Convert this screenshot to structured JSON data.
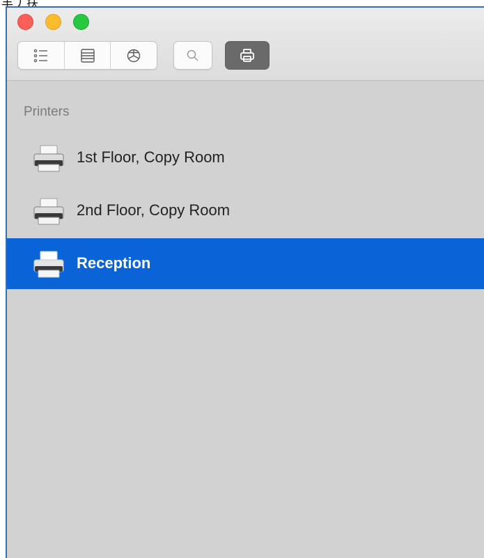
{
  "top_fragment": "丰丿扶",
  "toolbar": {
    "icons": [
      "list-view-icon",
      "column-view-icon",
      "network-icon",
      "search-icon",
      "printer-icon"
    ]
  },
  "sidebar": {
    "section_title": "Printers",
    "items": [
      {
        "label": "1st Floor, Copy Room",
        "selected": false
      },
      {
        "label": "2nd Floor, Copy Room",
        "selected": false
      },
      {
        "label": "Reception",
        "selected": true
      }
    ]
  },
  "colors": {
    "selection": "#0a64d8",
    "close": "#fc5f57",
    "minimize": "#fdbc2e",
    "maximize": "#28c840",
    "sidebar_bg": "#d2d2d2"
  }
}
